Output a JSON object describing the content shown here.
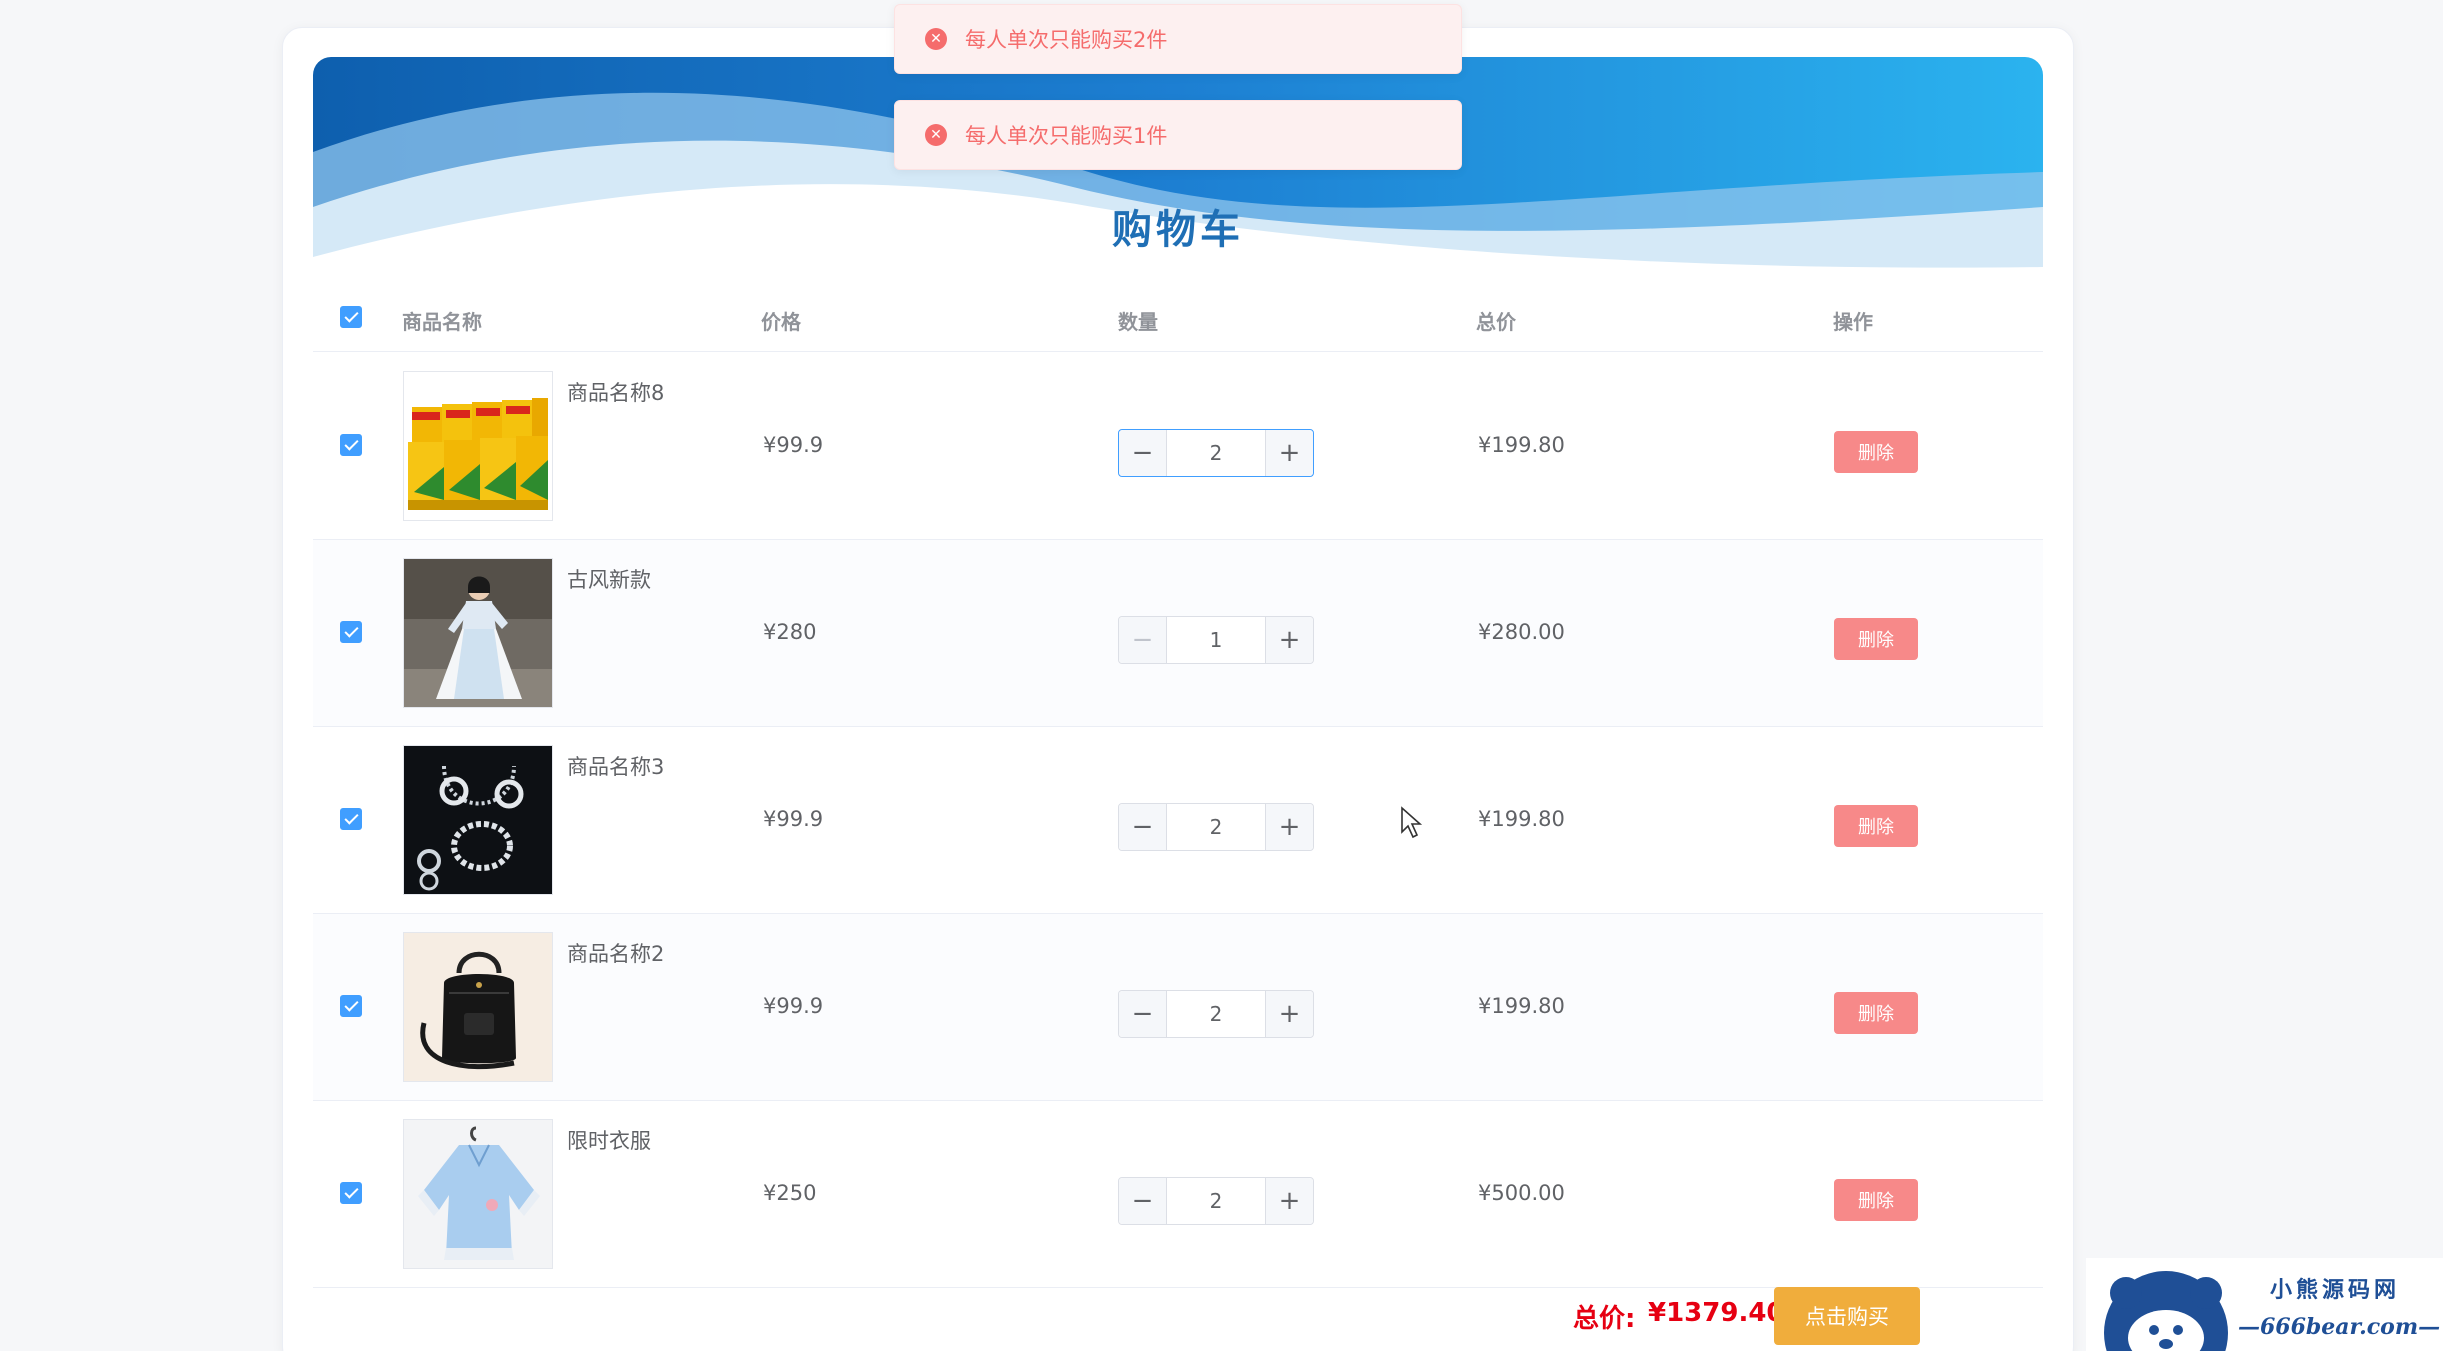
{
  "page": {
    "title": "购物车"
  },
  "toasts": [
    {
      "text": "每人单次只能购买2件",
      "icon": "error-circle-icon"
    },
    {
      "text": "每人单次只能购买1件",
      "icon": "error-circle-icon"
    }
  ],
  "table": {
    "headers": {
      "select_all_checked": true,
      "name": "商品名称",
      "price": "价格",
      "quantity": "数量",
      "total": "总价",
      "action": "操作"
    },
    "rows": [
      {
        "name": "商品名称8",
        "price": "¥99.9",
        "quantity": "2",
        "total": "¥199.80",
        "delete_label": "删除",
        "checked": true,
        "image": "juice-boxes"
      },
      {
        "name": "古风新款",
        "price": "¥280",
        "quantity": "1",
        "total": "¥280.00",
        "delete_label": "删除",
        "checked": true,
        "image": "hanfu-dress"
      },
      {
        "name": "商品名称3",
        "price": "¥99.9",
        "quantity": "2",
        "total": "¥199.80",
        "delete_label": "删除",
        "checked": true,
        "image": "jewelry-set"
      },
      {
        "name": "商品名称2",
        "price": "¥99.9",
        "quantity": "2",
        "total": "¥199.80",
        "delete_label": "删除",
        "checked": true,
        "image": "black-backpack"
      },
      {
        "name": "限时衣服",
        "price": "¥250",
        "quantity": "2",
        "total": "¥500.00",
        "delete_label": "删除",
        "checked": true,
        "image": "blue-blouse"
      }
    ]
  },
  "footer": {
    "total_label": "总价:",
    "total_value": "¥1379.40",
    "buy_label": "点击购买"
  },
  "watermark": {
    "line1": "小熊源码网",
    "line2": "—666bear.com—"
  },
  "colors": {
    "accent": "#409eff",
    "danger": "#f78989",
    "price_red": "#e60012",
    "buy_orange": "#f0ad3c",
    "banner_blue": "#1f86d6"
  }
}
